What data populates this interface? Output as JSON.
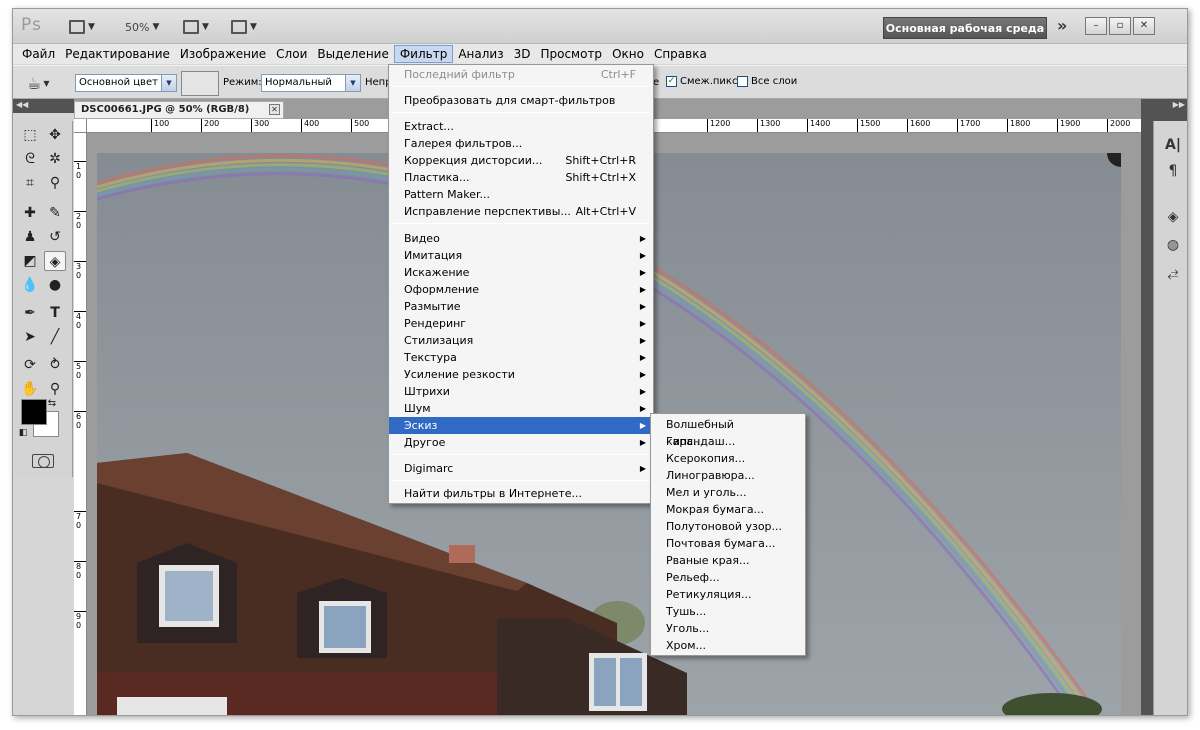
{
  "app": {
    "logo": "Ps",
    "zoom": "50%",
    "workspace": "Основная рабочая среда",
    "chevrons": "»",
    "window_controls": [
      "–",
      "▫",
      "✕"
    ]
  },
  "menubar": [
    "Файл",
    "Редактирование",
    "Изображение",
    "Слои",
    "Выделение",
    "Фильтр",
    "Анализ",
    "3D",
    "Просмотр",
    "Окно",
    "Справка"
  ],
  "options": {
    "fill_source": "Основной цвет",
    "mode_label": "Режим:",
    "mode_value": "Нормальный",
    "opacity_label_partial": "Непр",
    "tolerance_partial": "е",
    "contiguous_label": "Смеж.пикс",
    "all_layers_label": "Все слои"
  },
  "document": {
    "tab_title": "DSC00661.JPG @ 50% (RGB/8)",
    "close": "✕",
    "ruler_top": [
      "100",
      "200",
      "300",
      "400",
      "500",
      "1200",
      "1300",
      "1400",
      "1500",
      "1600",
      "1700",
      "1800",
      "1900",
      "2000"
    ],
    "ruler_left": [
      "1",
      "2",
      "3",
      "4",
      "5",
      "6",
      "7",
      "8",
      "9"
    ],
    "ruler_left_tail": "0"
  },
  "filter_menu": {
    "items": [
      {
        "label": "Последний фильтр",
        "shortcut": "Ctrl+F",
        "disabled": true
      },
      {
        "label": "Преобразовать для смарт-фильтров"
      },
      {
        "label": "Extract..."
      },
      {
        "label": "Галерея фильтров..."
      },
      {
        "label": "Коррекция дисторсии...",
        "shortcut": "Shift+Ctrl+R"
      },
      {
        "label": "Пластика...",
        "shortcut": "Shift+Ctrl+X"
      },
      {
        "label": "Pattern Maker..."
      },
      {
        "label": "Исправление перспективы...",
        "shortcut": "Alt+Ctrl+V"
      },
      {
        "label": "Видео",
        "sub": true
      },
      {
        "label": "Имитация",
        "sub": true
      },
      {
        "label": "Искажение",
        "sub": true
      },
      {
        "label": "Оформление",
        "sub": true
      },
      {
        "label": "Размытие",
        "sub": true
      },
      {
        "label": "Рендеринг",
        "sub": true
      },
      {
        "label": "Стилизация",
        "sub": true
      },
      {
        "label": "Текстура",
        "sub": true
      },
      {
        "label": "Усиление резкости",
        "sub": true
      },
      {
        "label": "Штрихи",
        "sub": true
      },
      {
        "label": "Шум",
        "sub": true
      },
      {
        "label": "Эскиз",
        "sub": true,
        "highlighted": true
      },
      {
        "label": "Другое",
        "sub": true
      },
      {
        "label": "Digimarc",
        "sub": true
      },
      {
        "label": "Найти фильтры в Интернете..."
      }
    ]
  },
  "sketch_submenu": {
    "items": [
      "Волшебный карандаш...",
      "Гипс...",
      "Ксерокопия...",
      "Линогравюра...",
      "Мел и уголь...",
      "Мокрая бумага...",
      "Полутоновой узор...",
      "Почтовая бумага...",
      "Рваные края...",
      "Рельеф...",
      "Ретикуляция...",
      "Тушь...",
      "Уголь...",
      "Хром..."
    ]
  },
  "colors": {
    "highlight": "#316ac5",
    "foreground": "#000000",
    "background": "#ffffff"
  }
}
